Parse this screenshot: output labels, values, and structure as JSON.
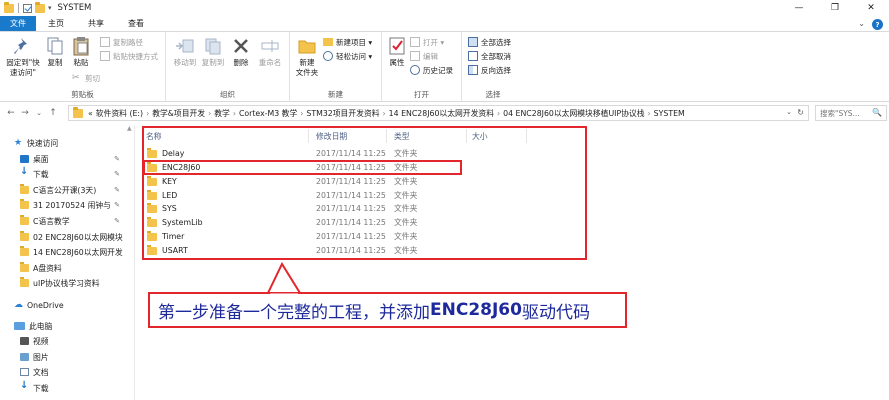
{
  "window": {
    "title": "SYSTEM",
    "qa_dropdown": "▾",
    "controls": [
      "—",
      "❐",
      "✕"
    ]
  },
  "tabs": {
    "file": "文件",
    "home": "主页",
    "share": "共享",
    "view": "查看",
    "chevron": "⌄",
    "help": "?"
  },
  "ribbon": {
    "clipboard": {
      "label": "剪贴板",
      "pin": "固定到\"快\n速访问\"",
      "copy": "复制",
      "paste": "粘贴",
      "copy_path": "复制路径",
      "paste_shortcut": "粘贴快捷方式",
      "cut": "剪切"
    },
    "organize": {
      "label": "组织",
      "move_to": "移动到",
      "copy_to": "复制到",
      "delete": "删除",
      "rename": "重命名"
    },
    "new": {
      "label": "新建",
      "new_folder": "新建\n文件夹",
      "new_item": "新建项目 ▾",
      "easy_access": "轻松访问 ▾"
    },
    "open": {
      "label": "打开",
      "properties": "属性",
      "open": "打开 ▾",
      "edit": "编辑",
      "history": "历史记录"
    },
    "select": {
      "label": "选择",
      "select_all": "全部选择",
      "select_none": "全部取消",
      "invert": "反向选择"
    }
  },
  "nav": {
    "back": "←",
    "forward": "→",
    "recent": "⌄",
    "up": "↑"
  },
  "address": {
    "crumbs": [
      "软件资料 (E:)",
      "教学&项目开发",
      "教学",
      "Cortex-M3 教学",
      "STM32项目开发资料",
      "14 ENC28J60以太网开发资料",
      "04 ENC28J60以太网模块移植UIP协议栈",
      "SYSTEM"
    ],
    "prefix": "«",
    "sep": "›",
    "dropdown": "⌄",
    "refresh": "↻"
  },
  "search": {
    "placeholder": "搜索\"SYS...",
    "icon": "🔍"
  },
  "sidebar": {
    "items": [
      {
        "label": "快速访问",
        "icon": "star-icon"
      },
      {
        "label": "桌面",
        "icon": "desktop-icon",
        "pin": "📌"
      },
      {
        "label": "下载",
        "icon": "download-icon",
        "pin": "📌"
      },
      {
        "label": "C语言公开课(3天)",
        "icon": "folder-icon",
        "pin": "📌"
      },
      {
        "label": "31 20170524 闹钟与",
        "icon": "folder-icon",
        "pin": "📌"
      },
      {
        "label": "C语言教学",
        "icon": "folder-icon",
        "pin": "📌"
      },
      {
        "label": "02 ENC28J60以太网模块",
        "icon": "folder-icon"
      },
      {
        "label": "14 ENC28J60以太网开发",
        "icon": "folder-icon"
      },
      {
        "label": "A盘资料",
        "icon": "folder-icon"
      },
      {
        "label": "uIP协议栈学习资料",
        "icon": "folder-icon"
      },
      {
        "label": "OneDrive",
        "icon": "cloud-icon"
      },
      {
        "label": "此电脑",
        "icon": "pc-icon"
      },
      {
        "label": "视频",
        "icon": "video-icon"
      },
      {
        "label": "图片",
        "icon": "picture-icon"
      },
      {
        "label": "文档",
        "icon": "document-icon"
      },
      {
        "label": "下载",
        "icon": "download-icon"
      }
    ]
  },
  "columns": {
    "name": "名称",
    "modified": "修改日期",
    "type": "类型",
    "size": "大小"
  },
  "files": [
    {
      "name": "Delay",
      "modified": "2017/11/14 11:25",
      "type": "文件夹"
    },
    {
      "name": "ENC28J60",
      "modified": "2017/11/14 11:25",
      "type": "文件夹"
    },
    {
      "name": "KEY",
      "modified": "2017/11/14 11:25",
      "type": "文件夹"
    },
    {
      "name": "LED",
      "modified": "2017/11/14 11:25",
      "type": "文件夹"
    },
    {
      "name": "SYS",
      "modified": "2017/11/14 11:25",
      "type": "文件夹"
    },
    {
      "name": "SystemLib",
      "modified": "2017/11/14 11:25",
      "type": "文件夹"
    },
    {
      "name": "Timer",
      "modified": "2017/11/14 11:25",
      "type": "文件夹"
    },
    {
      "name": "USART",
      "modified": "2017/11/14 11:25",
      "type": "文件夹"
    }
  ],
  "annotation": {
    "text_cn1": "第一步准备一个完整的工程，并添加",
    "text_en": "ENC28J60",
    "text_cn2": "驱动代码",
    "color": "#e3262c",
    "text_color": "#1e2a9c"
  },
  "colors": {
    "accent": "#1979ca",
    "folder": "#f3c34b"
  }
}
